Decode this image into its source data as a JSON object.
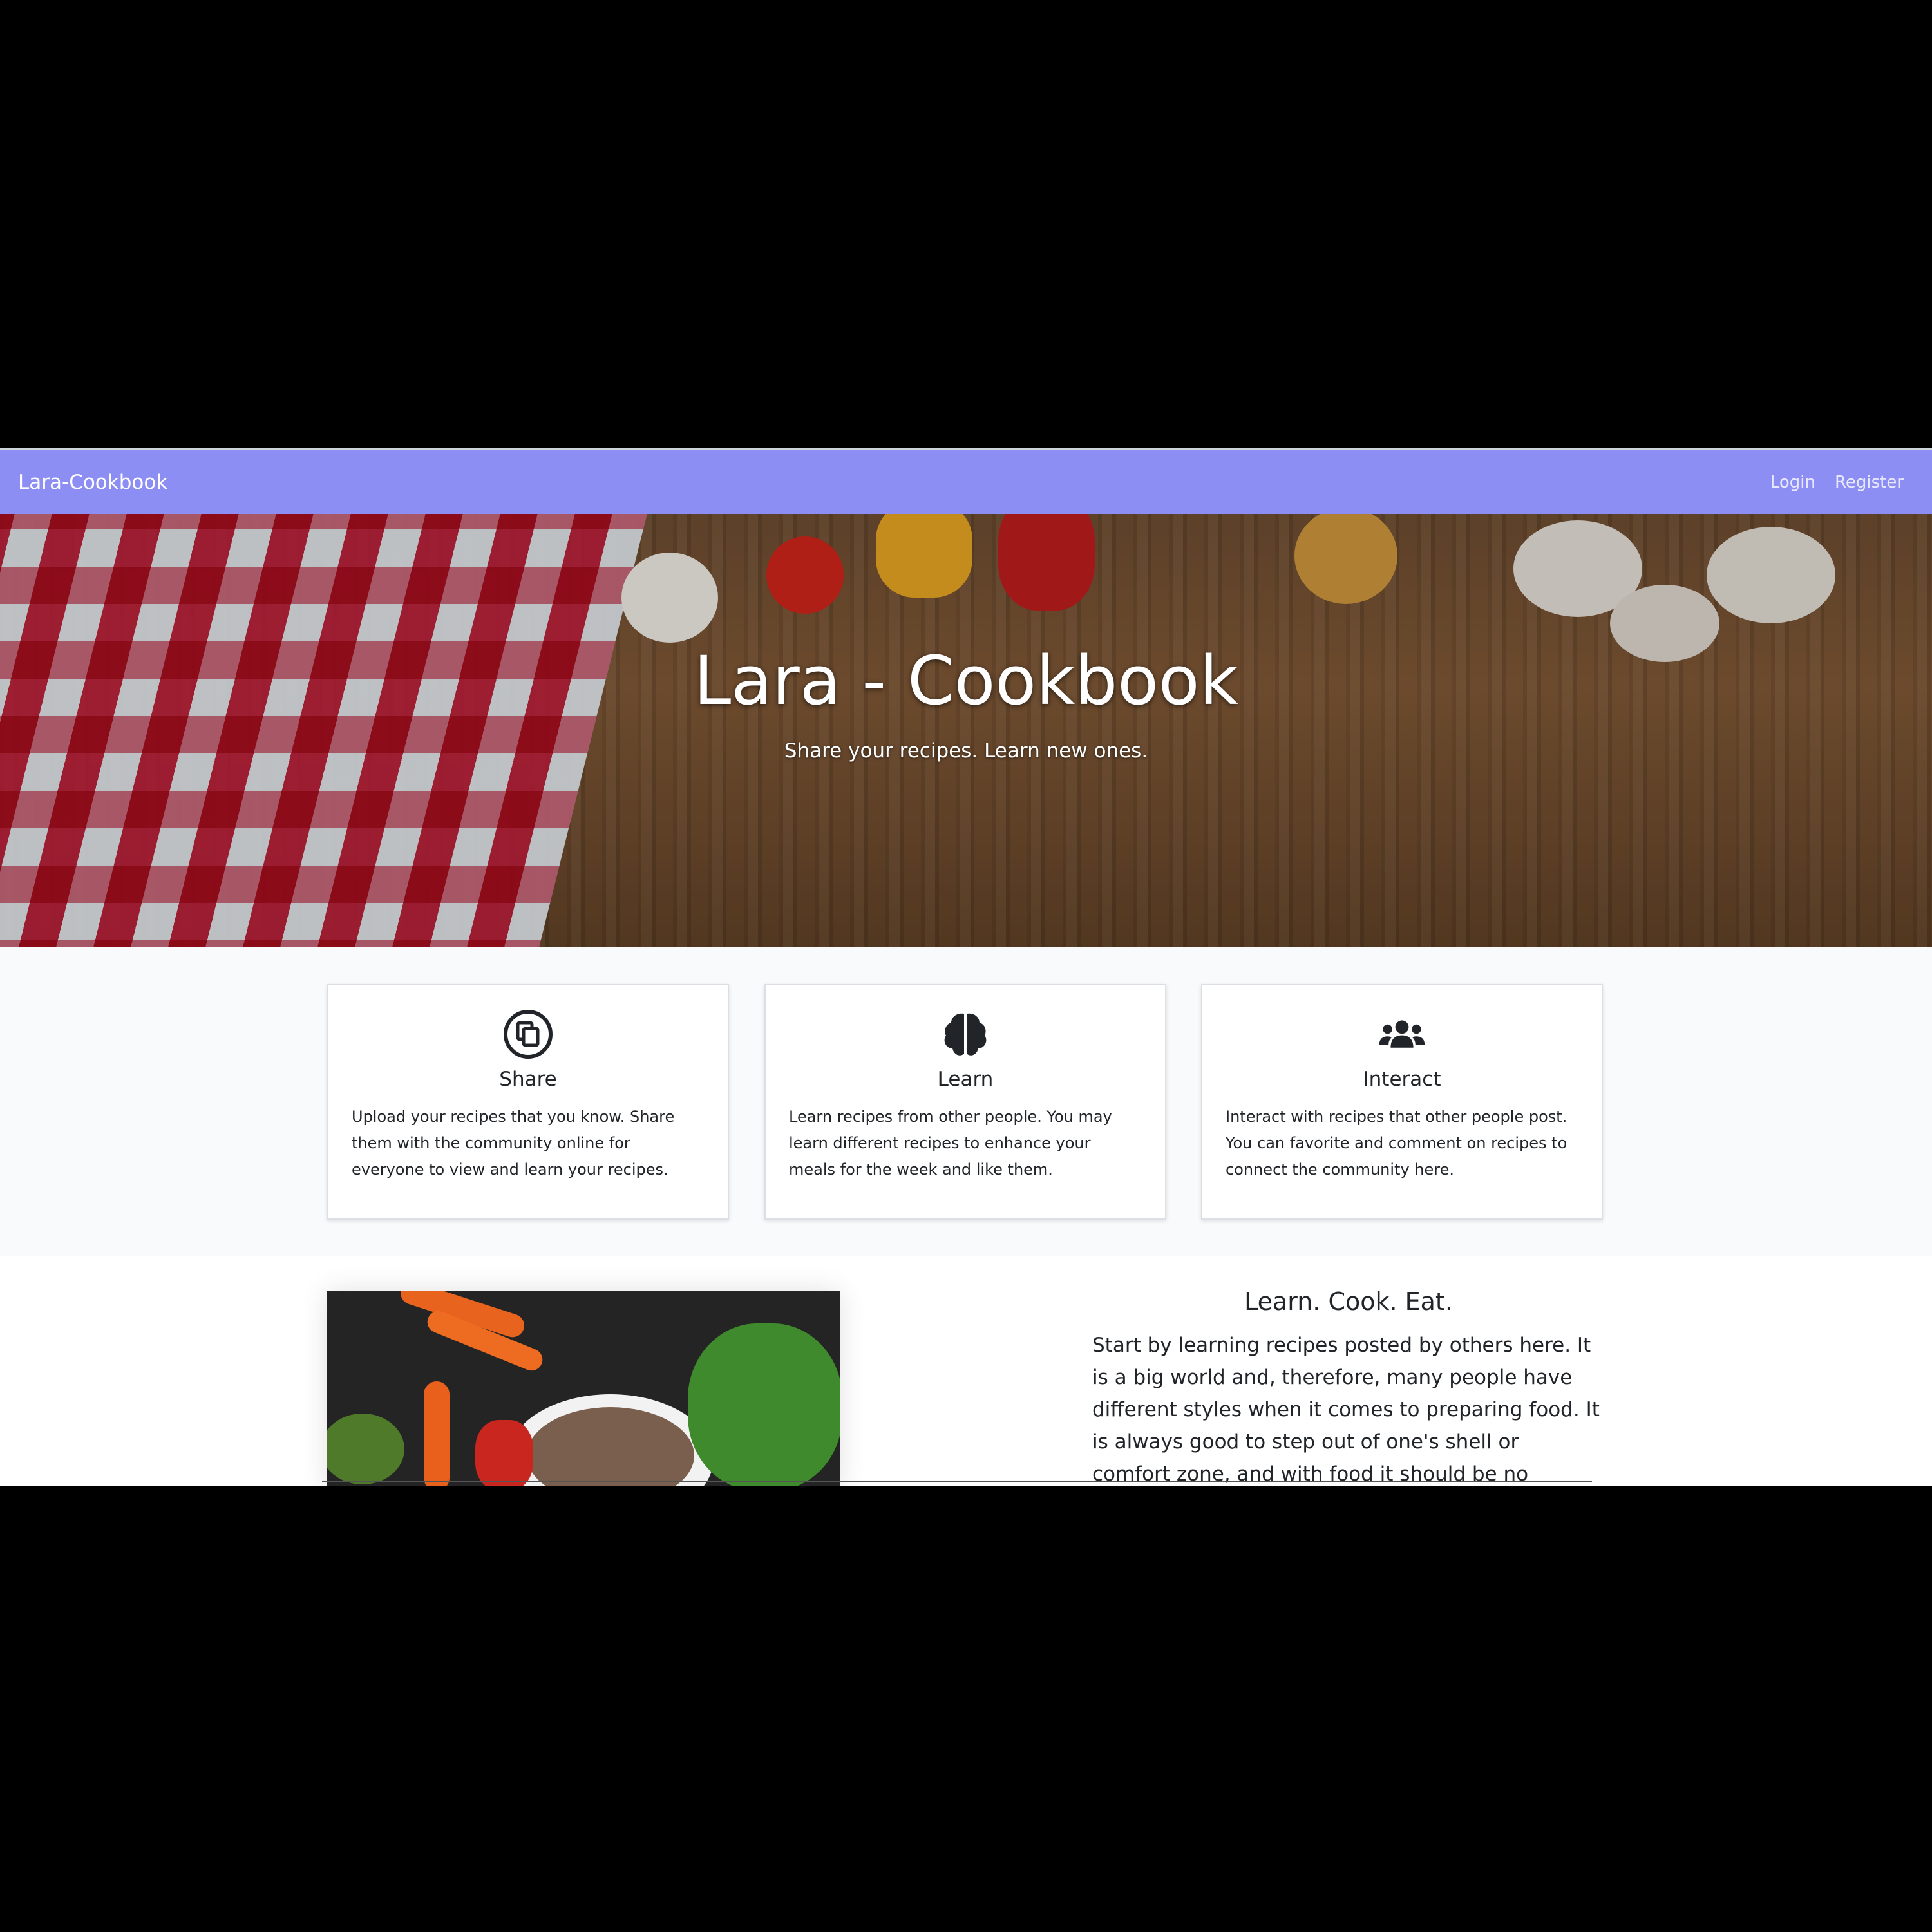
{
  "navbar": {
    "brand": "Lara-Cookbook",
    "login": "Login",
    "register": "Register",
    "background": "#8c8ef3"
  },
  "hero": {
    "title": "Lara - Cookbook",
    "subtitle": "Share your recipes. Learn new ones."
  },
  "features": [
    {
      "icon": "share-copy-icon",
      "title": "Share",
      "text": "Upload your recipes that you know. Share them with the community online for everyone to view and learn your recipes."
    },
    {
      "icon": "brain-icon",
      "title": "Learn",
      "text": "Learn recipes from other people. You may learn different recipes to enhance your meals for the week and like them."
    },
    {
      "icon": "users-icon",
      "title": "Interact",
      "text": "Interact with recipes that other people post. You can favorite and comment on recipes to connect the community here."
    }
  ],
  "about": {
    "title": "Learn. Cook. Eat.",
    "text": "Start by learning recipes posted by others here. It is a big world and, therefore, many people have different styles when it comes to preparing food. It is always good to step out of one's shell or comfort zone, and with food it should be no different (unless of course"
  }
}
